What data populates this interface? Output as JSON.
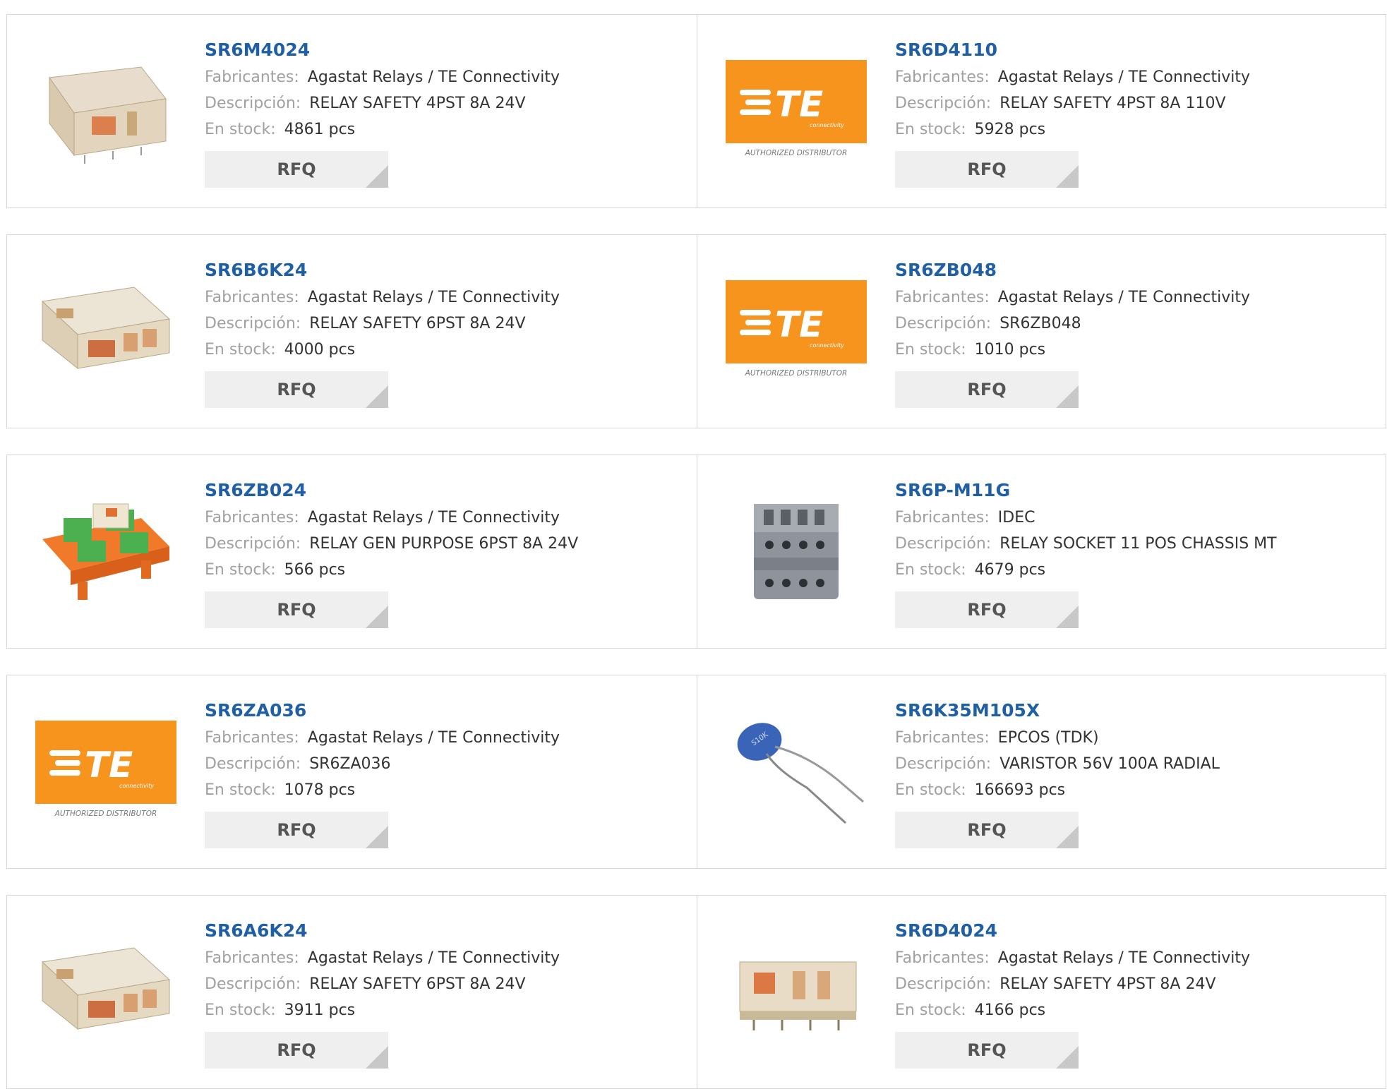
{
  "labels": {
    "manufacturer": "Fabricantes:",
    "description": "Descripción:",
    "stock": "En stock:",
    "rfq": "RFQ"
  },
  "logo": {
    "brand": "TE",
    "sub": "connectivity",
    "caption": "AUTHORIZED DISTRIBUTOR",
    "color": "#F7941D"
  },
  "products": [
    {
      "part": "SR6M4024",
      "manufacturer": "Agastat Relays / TE Connectivity",
      "description": "RELAY SAFETY 4PST 8A 24V",
      "stock": "4861 pcs",
      "image": "relay-4pst-icon"
    },
    {
      "part": "SR6D4110",
      "manufacturer": "Agastat Relays / TE Connectivity",
      "description": "RELAY SAFETY 4PST 8A 110V",
      "stock": "5928 pcs",
      "image": "te-logo"
    },
    {
      "part": "SR6B6K24",
      "manufacturer": "Agastat Relays / TE Connectivity",
      "description": "RELAY SAFETY 6PST 8A 24V",
      "stock": "4000 pcs",
      "image": "relay-6pst-icon"
    },
    {
      "part": "SR6ZB048",
      "manufacturer": "Agastat Relays / TE Connectivity",
      "description": "SR6ZB048",
      "stock": "1010 pcs",
      "image": "te-logo"
    },
    {
      "part": "SR6ZB024",
      "manufacturer": "Agastat Relays / TE Connectivity",
      "description": "RELAY GEN PURPOSE 6PST 8A 24V",
      "stock": "566 pcs",
      "image": "relay-module-icon"
    },
    {
      "part": "SR6P-M11G",
      "manufacturer": "IDEC",
      "description": "RELAY SOCKET 11 POS CHASSIS MT",
      "stock": "4679 pcs",
      "image": "relay-socket-icon"
    },
    {
      "part": "SR6ZA036",
      "manufacturer": "Agastat Relays / TE Connectivity",
      "description": "SR6ZA036",
      "stock": "1078 pcs",
      "image": "te-logo"
    },
    {
      "part": "SR6K35M105X",
      "manufacturer": "EPCOS (TDK)",
      "description": "VARISTOR 56V 100A RADIAL",
      "stock": "166693 pcs",
      "image": "varistor-icon"
    },
    {
      "part": "SR6A6K24",
      "manufacturer": "Agastat Relays / TE Connectivity",
      "description": "RELAY SAFETY 6PST 8A 24V",
      "stock": "3911 pcs",
      "image": "relay-6pst-icon"
    },
    {
      "part": "SR6D4024",
      "manufacturer": "Agastat Relays / TE Connectivity",
      "description": "RELAY SAFETY 4PST 8A 24V",
      "stock": "4166 pcs",
      "image": "relay-4pst-flat-icon"
    }
  ]
}
